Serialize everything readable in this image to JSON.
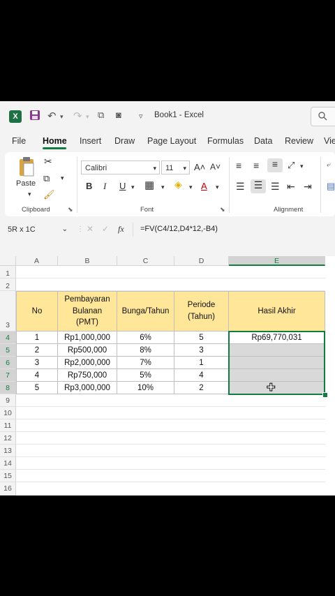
{
  "title_bar": {
    "app_icon_letter": "X",
    "document_title": "Book1 - Excel"
  },
  "tabs": [
    {
      "label": "File",
      "active": false
    },
    {
      "label": "Home",
      "active": true
    },
    {
      "label": "Insert",
      "active": false
    },
    {
      "label": "Draw",
      "active": false
    },
    {
      "label": "Page Layout",
      "active": false
    },
    {
      "label": "Formulas",
      "active": false
    },
    {
      "label": "Data",
      "active": false
    },
    {
      "label": "Review",
      "active": false
    },
    {
      "label": "Vie",
      "active": false
    }
  ],
  "ribbon": {
    "paste_label": "Paste",
    "clipboard_label": "Clipboard",
    "font_label": "Font",
    "alignment_label": "Alignment",
    "font_name": "Calibri",
    "font_size": "11",
    "bold": "B",
    "italic": "I",
    "underline": "U",
    "font_color_icon": "A",
    "grow_font": "A˄",
    "shrink_font": "A˅"
  },
  "formula_bar": {
    "name_box": "5R x 1C",
    "fx": "fx",
    "formula": "=FV(C4/12,D4*12,-B4)"
  },
  "columns": [
    "A",
    "B",
    "C",
    "D",
    "E"
  ],
  "rows": [
    "1",
    "2",
    "3",
    "4",
    "5",
    "6",
    "7",
    "8",
    "9",
    "10",
    "11",
    "12",
    "13",
    "14",
    "15",
    "16"
  ],
  "table": {
    "headers": [
      "No",
      "Pembayaran\nBulanan\n(PMT)",
      "Bunga/Tahun",
      "Periode\n(Tahun)",
      "Hasil Akhir"
    ],
    "rows": [
      [
        "1",
        "Rp1,000,000",
        "6%",
        "5",
        "Rp69,770,031"
      ],
      [
        "2",
        "Rp500,000",
        "8%",
        "3",
        ""
      ],
      [
        "3",
        "Rp2,000,000",
        "7%",
        "1",
        ""
      ],
      [
        "4",
        "Rp750,000",
        "5%",
        "4",
        ""
      ],
      [
        "5",
        "Rp3,000,000",
        "10%",
        "2",
        ""
      ]
    ]
  },
  "colors": {
    "header_fill": "#ffe699",
    "accent": "#107c41",
    "selection_fill": "#d9d9d9"
  }
}
